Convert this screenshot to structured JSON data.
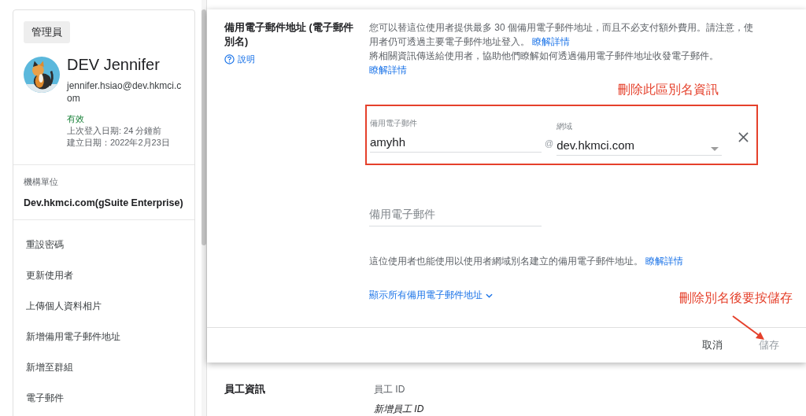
{
  "sidebar": {
    "role_badge": "管理員",
    "user": {
      "name": "DEV Jennifer",
      "email": "jennifer.hsiao@dev.hkmci.com",
      "status": "有效",
      "last_login": "上次登入日期: 24 分鐘前",
      "created": "建立日期：2022年2月23日"
    },
    "org_unit": {
      "label": "機構單位",
      "value": "Dev.hkmci.com(gSuite Enterprise)"
    },
    "actions": [
      "重設密碼",
      "更新使用者",
      "上傳個人資料相片",
      "新增備用電子郵件地址",
      "新增至群組",
      "電子郵件"
    ]
  },
  "dialog": {
    "title": "備用電子郵件地址 (電子郵件別名)",
    "help": "說明",
    "description": [
      {
        "text": "您可以替這位使用者提供最多 30 個備用電子郵件地址，而且不必支付額外費用。請注意，使用者仍可透過主要電子郵件地址登入。",
        "link": "瞭解詳情"
      },
      {
        "text": "將相關資訊傳送給使用者，協助他們瞭解如何透過備用電子郵件地址收發電子郵件。",
        "link": "瞭解詳情"
      }
    ],
    "alias": {
      "label": "備用電子郵件",
      "value": "amyhh",
      "at": "@",
      "domain_label": "網域",
      "domain": "dev.hkmci.com"
    },
    "new_alias": {
      "placeholder": "備用電子郵件"
    },
    "note": {
      "text": "這位使用者也能使用以使用者網域別名建立的備用電子郵件地址。",
      "link": "瞭解詳情"
    },
    "show_all": "顯示所有備用電子郵件地址",
    "buttons": [
      {
        "label": "取消",
        "disabled": false
      },
      {
        "label": "儲存",
        "disabled": true
      }
    ]
  },
  "annotations": [
    {
      "text": "刪除此區別名資訊"
    },
    {
      "text": "刪除別名後要按儲存"
    }
  ],
  "employee_section": {
    "title": "員工資訊",
    "field_label": "員工 ID",
    "field_value": "新增員工 ID"
  }
}
